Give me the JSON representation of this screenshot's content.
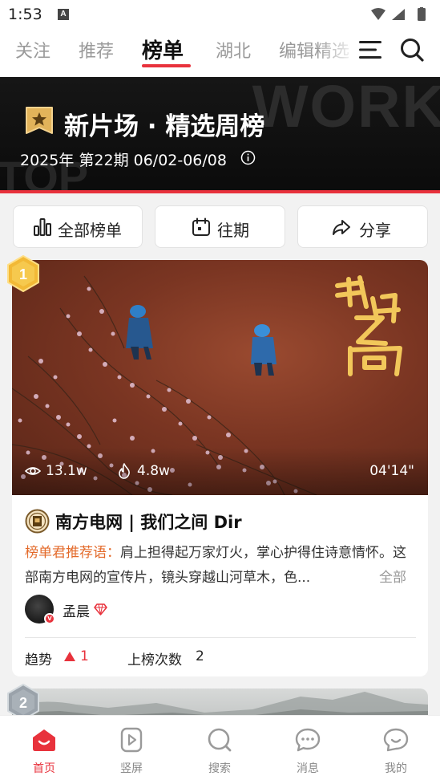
{
  "status_bar": {
    "time": "1:53",
    "notification_icon": "A"
  },
  "tabs": [
    {
      "label": "关注",
      "active": false
    },
    {
      "label": "推荐",
      "active": false
    },
    {
      "label": "榜单",
      "active": true
    },
    {
      "label": "湖北",
      "active": false
    },
    {
      "label": "编辑精选",
      "active": false
    }
  ],
  "banner": {
    "watermark_top_right": "WORK",
    "watermark_left": "TOP",
    "title": "新片场 · 精选周榜",
    "subtitle": "2025年 第22期 06/02-06/08"
  },
  "actions": {
    "all_rankings": "全部榜单",
    "past_issues": "往期",
    "share": "分享"
  },
  "entries": [
    {
      "rank": "1",
      "views": "13.1w",
      "hot": "4.8w",
      "duration": "04'14\"",
      "title": "南方电网 | 我们之间 Dir",
      "recommend_label": "榜单君推荐语：",
      "description": "肩上担得起万家灯火，掌心护得住诗意情怀。这部南方电网的宣传片，镜头穿越山河草木，色...",
      "more_label": "全部",
      "author": "孟晨",
      "trend_label": "趋势",
      "trend_value": "1",
      "count_label": "上榜次数",
      "count_value": "2"
    },
    {
      "rank": "2"
    }
  ],
  "bottom_nav": [
    {
      "label": "首页",
      "icon": "home-icon",
      "active": true
    },
    {
      "label": "竖屏",
      "icon": "vertical-video-icon",
      "active": false
    },
    {
      "label": "搜索",
      "icon": "search-icon",
      "active": false
    },
    {
      "label": "消息",
      "icon": "message-icon",
      "active": false
    },
    {
      "label": "我的",
      "icon": "profile-icon",
      "active": false
    }
  ],
  "colors": {
    "accent": "#e8323c",
    "recommend": "#e36a2a",
    "gold": "#f0b43a"
  }
}
